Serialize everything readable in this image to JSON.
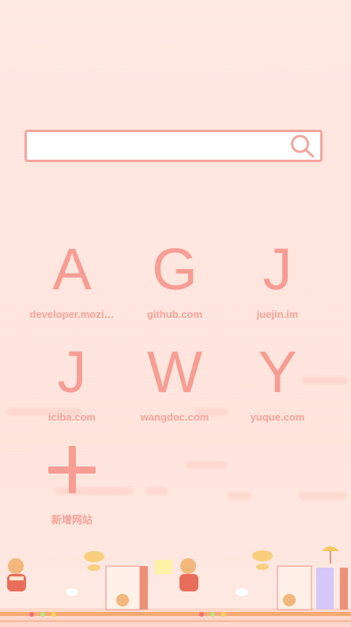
{
  "search": {
    "placeholder": "",
    "value": ""
  },
  "sites": [
    {
      "letter": "A",
      "label": "developer.mozi…"
    },
    {
      "letter": "G",
      "label": "github.com"
    },
    {
      "letter": "J",
      "label": "juejin.im"
    },
    {
      "letter": "J",
      "label": "iciba.com"
    },
    {
      "letter": "W",
      "label": "wangdoc.com"
    },
    {
      "letter": "Y",
      "label": "yuque.com"
    }
  ],
  "add_site": {
    "label": "新增网站"
  },
  "colors": {
    "accent": "#f79d94",
    "background": "#ffe8e1",
    "search_border": "#f6a59c"
  },
  "icons": {
    "search": "search-icon",
    "add": "plus-icon"
  }
}
